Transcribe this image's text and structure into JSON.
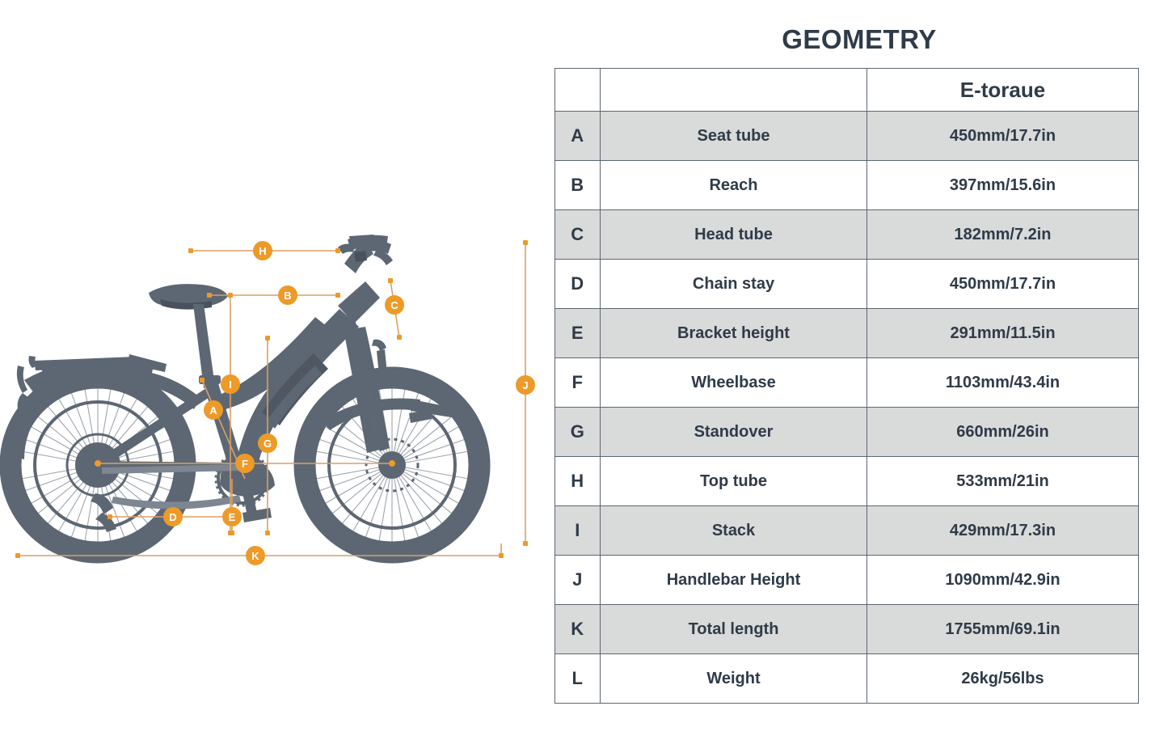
{
  "title": "GEOMETRY",
  "table": {
    "header": {
      "letter_col": "",
      "name_col": "",
      "model": "E-toraue"
    },
    "rows": [
      {
        "letter": "A",
        "name": "Seat tube",
        "value": "450mm/17.7in",
        "shaded": true
      },
      {
        "letter": "B",
        "name": "Reach",
        "value": "397mm/15.6in",
        "shaded": false
      },
      {
        "letter": "C",
        "name": "Head tube",
        "value": "182mm/7.2in",
        "shaded": true
      },
      {
        "letter": "D",
        "name": "Chain stay",
        "value": "450mm/17.7in",
        "shaded": false
      },
      {
        "letter": "E",
        "name": "Bracket height",
        "value": "291mm/11.5in",
        "shaded": true
      },
      {
        "letter": "F",
        "name": "Wheelbase",
        "value": "1103mm/43.4in",
        "shaded": false
      },
      {
        "letter": "G",
        "name": "Standover",
        "value": "660mm/26in",
        "shaded": true
      },
      {
        "letter": "H",
        "name": "Top tube",
        "value": "533mm/21in",
        "shaded": false
      },
      {
        "letter": "I",
        "name": "Stack",
        "value": "429mm/17.3in",
        "shaded": true
      },
      {
        "letter": "J",
        "name": "Handlebar Height",
        "value": "1090mm/42.9in",
        "shaded": false
      },
      {
        "letter": "K",
        "name": "Total length",
        "value": "1755mm/69.1in",
        "shaded": true
      },
      {
        "letter": "L",
        "name": "Weight",
        "value": "26kg/56lbs",
        "shaded": false
      }
    ]
  },
  "diagram": {
    "markers": [
      {
        "id": "A",
        "label": "A"
      },
      {
        "id": "B",
        "label": "B"
      },
      {
        "id": "C",
        "label": "C"
      },
      {
        "id": "D",
        "label": "D"
      },
      {
        "id": "E",
        "label": "E"
      },
      {
        "id": "F",
        "label": "F"
      },
      {
        "id": "G",
        "label": "G"
      },
      {
        "id": "H",
        "label": "H"
      },
      {
        "id": "I",
        "label": "I"
      },
      {
        "id": "J",
        "label": "J"
      },
      {
        "id": "K",
        "label": "K"
      }
    ]
  },
  "colors": {
    "accent": "#ED9A28",
    "accent_line": "#D9A066",
    "bike": "#5d6773",
    "text": "#2f3b48",
    "row_shade": "#d9dada",
    "border": "#5c6670",
    "background": "#ffffff"
  }
}
